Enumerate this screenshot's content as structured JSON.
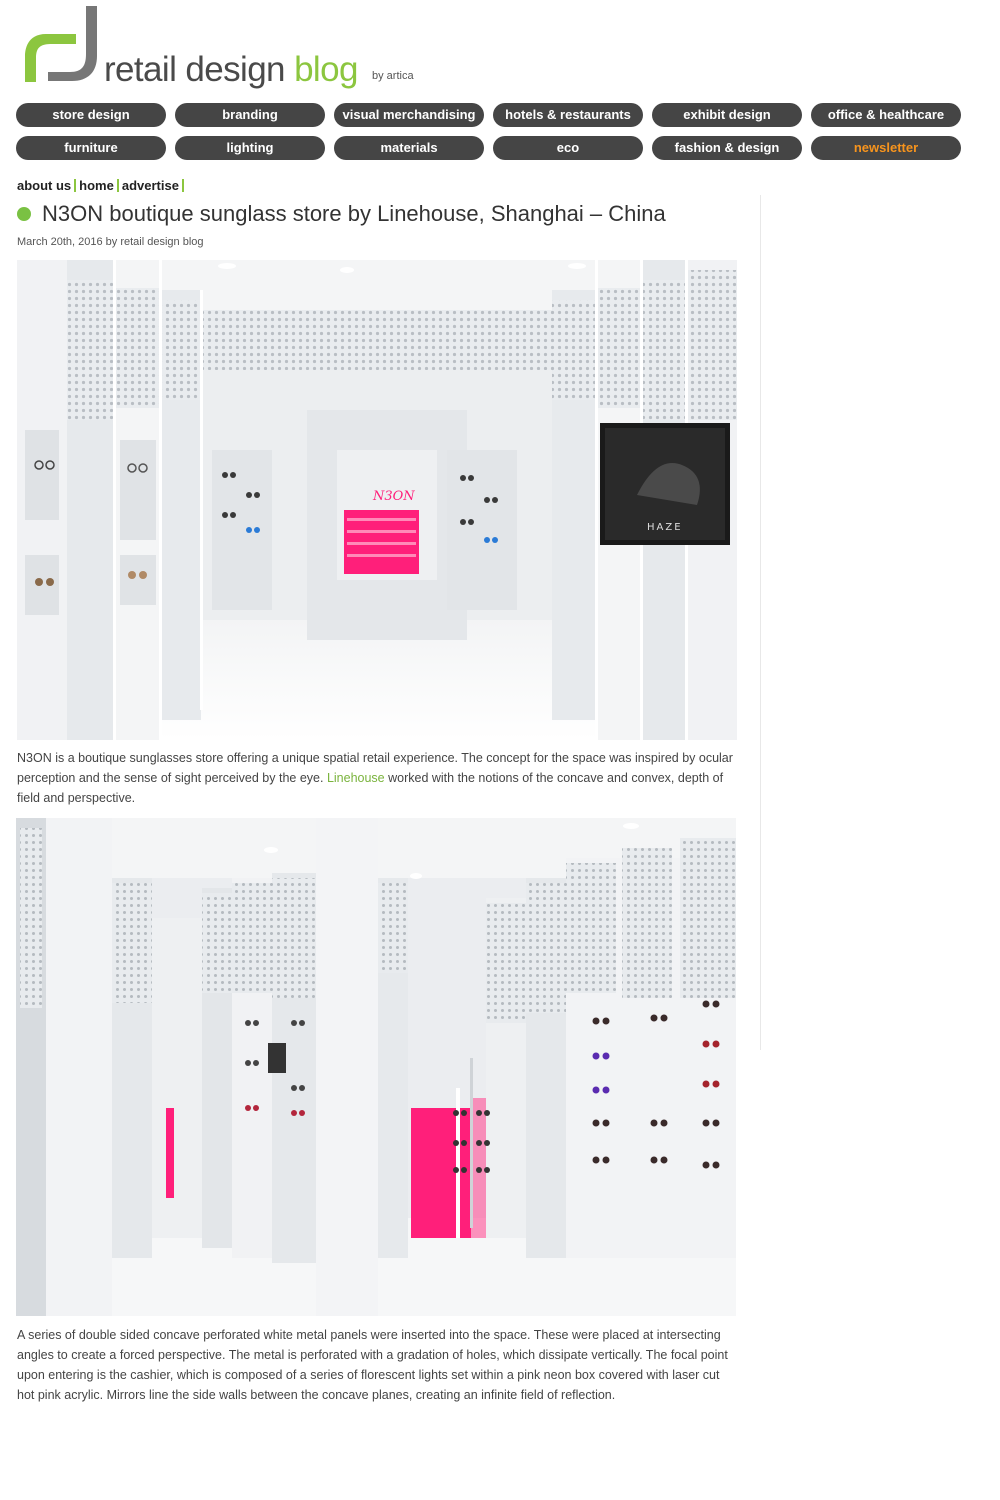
{
  "site": {
    "logo_word_1": "retail design",
    "logo_word_2": "blog",
    "logo_by": "by artica",
    "logo_icon": "rdb-logo-icon"
  },
  "nav": {
    "row1": [
      "store design",
      "branding",
      "visual merchandising",
      "hotels & restaurants",
      "exhibit design",
      "office & healthcare"
    ],
    "row2": [
      "furniture",
      "lighting",
      "materials",
      "eco",
      "fashion & design",
      "newsletter"
    ]
  },
  "toplinks": [
    "about us",
    "home",
    "advertise"
  ],
  "post": {
    "title": "N3ON boutique sunglass store by Linehouse, Shanghai – China",
    "meta": "March 20th, 2016 by retail design blog",
    "para1_before": "N3ON is a boutique sunglasses store offering a unique spatial retail experience. The concept for the space was inspired by ocular perception and the sense of sight perceived by the eye. ",
    "para1_link": "Linehouse",
    "para1_after": " worked with the notions of the concave and convex, depth of field and perspective.",
    "para2": "A series of double sided concave perforated white metal panels were inserted into the space. These were placed at intersecting angles to create a forced perspective. The metal is perforated with a gradation of holes, which dissipate vertically. The focal point upon entering is the cashier, which is composed of a series of florescent lights set within a pink neon box covered with laser cut hot pink acrylic. Mirrors line the side walls between the concave planes, creating an infinite field of reflection.",
    "photo1_screen_text": "HAZE",
    "photo1_sign_text": "N3ON"
  },
  "colors": {
    "accent_green": "#8cc63f",
    "nav_bg": "#454545",
    "newsletter": "#f7941d",
    "link": "#7ab33d",
    "neon_pink": "#ff1f7a"
  }
}
